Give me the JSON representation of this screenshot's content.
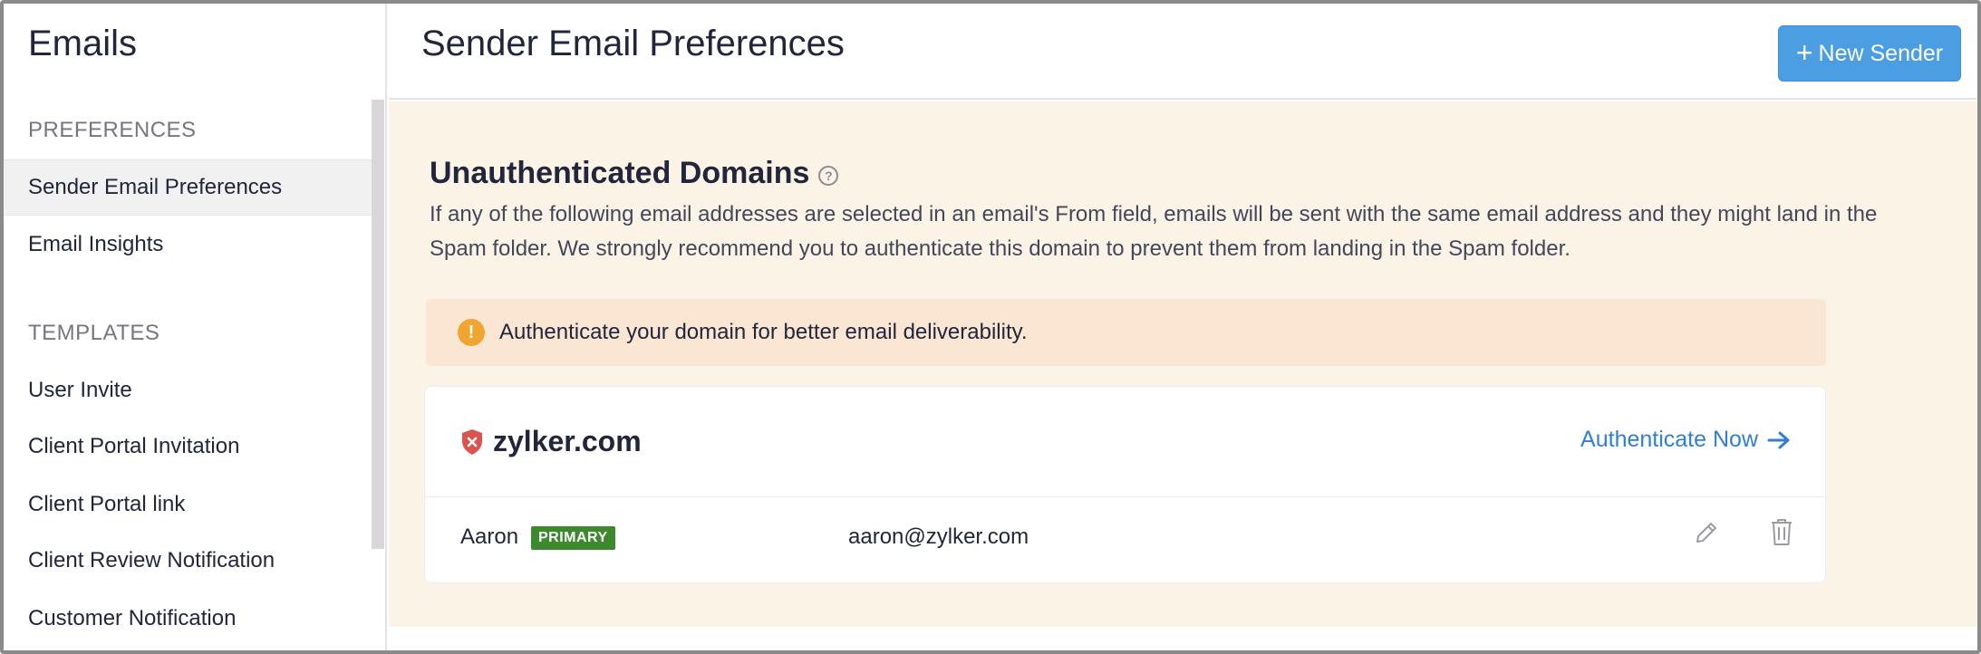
{
  "sidebar": {
    "title": "Emails",
    "sections": [
      {
        "label": "PREFERENCES",
        "items": [
          {
            "label": "Sender Email Preferences",
            "active": true
          },
          {
            "label": "Email Insights",
            "active": false
          }
        ]
      },
      {
        "label": "TEMPLATES",
        "items": [
          {
            "label": "User Invite"
          },
          {
            "label": "Client Portal Invitation"
          },
          {
            "label": "Client Portal link"
          },
          {
            "label": "Client Review Notification"
          },
          {
            "label": "Customer Notification"
          }
        ]
      }
    ]
  },
  "header": {
    "title": "Sender Email Preferences",
    "new_sender_label": "New Sender",
    "new_sender_icon": "plus-icon"
  },
  "main": {
    "heading": "Unauthenticated Domains",
    "heading_icon": "help-circle-icon",
    "description": "If any of the following email addresses are selected in an email's From field, emails will be sent with the same email address and they might land in the Spam folder. We strongly recommend you to authenticate this domain to prevent them from landing in the Spam folder.",
    "alert": {
      "icon": "warning-icon",
      "text": "Authenticate your domain for better email deliverability."
    },
    "domain_card": {
      "domain": "zylker.com",
      "status_icon": "unverified-shield-icon",
      "action_label": "Authenticate Now",
      "action_icon": "arrow-right-icon",
      "senders": [
        {
          "name": "Aaron",
          "badge": "PRIMARY",
          "email": "aaron@zylker.com"
        }
      ]
    }
  },
  "colors": {
    "accent": "#4b9ee2",
    "link": "#2f7fd6",
    "content_bg": "#fcf3e7",
    "alert_bg": "#fae6d2",
    "warning": "#f0a530",
    "badge": "#3d8a2e",
    "error": "#d9534f"
  }
}
